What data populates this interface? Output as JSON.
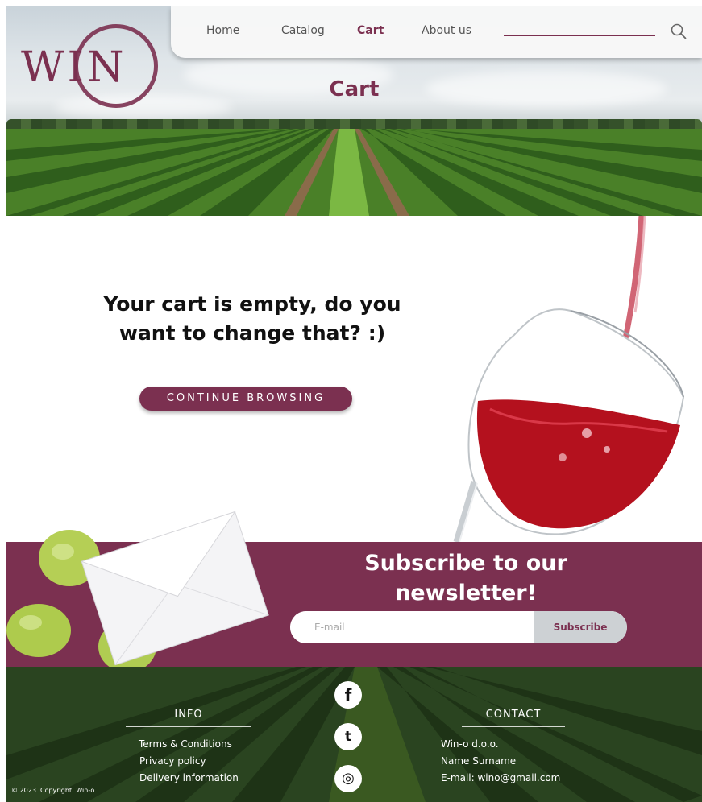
{
  "brand": {
    "logo_text": "WIN",
    "accent": "#7b3050"
  },
  "nav": {
    "items": [
      {
        "label": "Home",
        "active": false
      },
      {
        "label": "Catalog",
        "active": false
      },
      {
        "label": "Cart",
        "active": true
      },
      {
        "label": "About us",
        "active": false
      }
    ],
    "search_icon": "search-icon"
  },
  "hero": {
    "title": "Cart"
  },
  "main": {
    "message_line1": "Your cart is empty, do you",
    "message_line2": "want to change that? :)",
    "continue_label": "CONTINUE BROWSING"
  },
  "newsletter": {
    "title_line1": "Subscribe to our",
    "title_line2": "newsletter!",
    "email_placeholder": "E-mail",
    "button_label": "Subscribe"
  },
  "footer": {
    "info": {
      "title": "INFO",
      "links": [
        "Terms & Conditions",
        "Privacy policy",
        "Delivery information"
      ]
    },
    "social": [
      {
        "icon": "facebook-icon",
        "glyph": "f"
      },
      {
        "icon": "twitter-icon",
        "glyph": "t"
      },
      {
        "icon": "instagram-icon",
        "glyph": "◎"
      }
    ],
    "contact": {
      "title": "CONTACT",
      "lines": [
        "Win-o d.o.o.",
        "Name Surname",
        "E-mail: wino@gmail.com"
      ]
    },
    "copyright": "© 2023. Copyright: Win-o"
  }
}
